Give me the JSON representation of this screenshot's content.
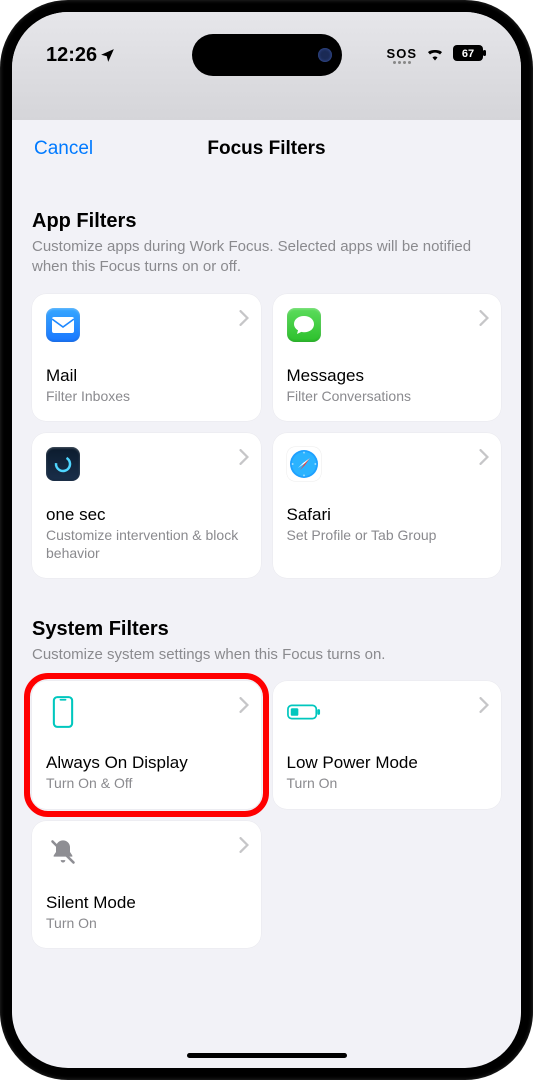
{
  "status": {
    "time": "12:26",
    "sos": "SOS",
    "battery": "67"
  },
  "nav": {
    "cancel": "Cancel",
    "title": "Focus Filters"
  },
  "appFilters": {
    "title": "App Filters",
    "subtitle": "Customize apps during Work Focus. Selected apps will be notified when this Focus turns on or off.",
    "items": [
      {
        "title": "Mail",
        "sub": "Filter Inboxes"
      },
      {
        "title": "Messages",
        "sub": "Filter Conversations"
      },
      {
        "title": "one sec",
        "sub": "Customize intervention & block behavior"
      },
      {
        "title": "Safari",
        "sub": "Set Profile or Tab Group"
      }
    ]
  },
  "systemFilters": {
    "title": "System Filters",
    "subtitle": "Customize system settings when this Focus turns on.",
    "items": [
      {
        "title": "Always On Display",
        "sub": "Turn On & Off"
      },
      {
        "title": "Low Power Mode",
        "sub": "Turn On"
      },
      {
        "title": "Silent Mode",
        "sub": "Turn On"
      }
    ]
  }
}
